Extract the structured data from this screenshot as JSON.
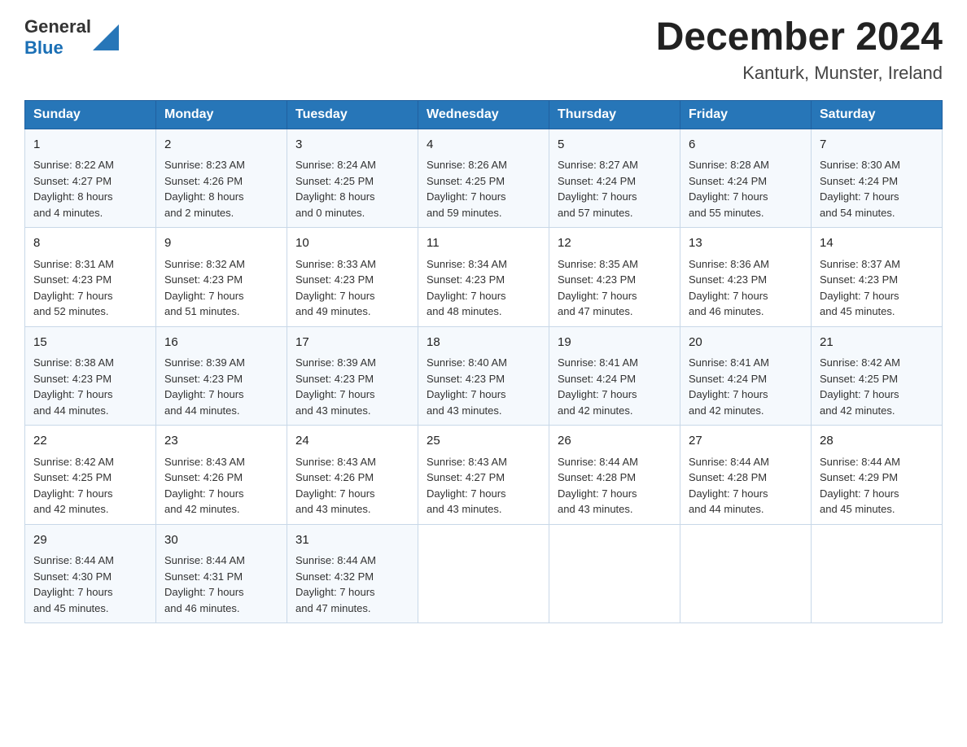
{
  "logo": {
    "text_general": "General",
    "text_blue": "Blue"
  },
  "title": "December 2024",
  "subtitle": "Kanturk, Munster, Ireland",
  "days_of_week": [
    "Sunday",
    "Monday",
    "Tuesday",
    "Wednesday",
    "Thursday",
    "Friday",
    "Saturday"
  ],
  "weeks": [
    [
      {
        "day": "1",
        "sunrise": "8:22 AM",
        "sunset": "4:27 PM",
        "daylight": "8 hours and 4 minutes."
      },
      {
        "day": "2",
        "sunrise": "8:23 AM",
        "sunset": "4:26 PM",
        "daylight": "8 hours and 2 minutes."
      },
      {
        "day": "3",
        "sunrise": "8:24 AM",
        "sunset": "4:25 PM",
        "daylight": "8 hours and 0 minutes."
      },
      {
        "day": "4",
        "sunrise": "8:26 AM",
        "sunset": "4:25 PM",
        "daylight": "7 hours and 59 minutes."
      },
      {
        "day": "5",
        "sunrise": "8:27 AM",
        "sunset": "4:24 PM",
        "daylight": "7 hours and 57 minutes."
      },
      {
        "day": "6",
        "sunrise": "8:28 AM",
        "sunset": "4:24 PM",
        "daylight": "7 hours and 55 minutes."
      },
      {
        "day": "7",
        "sunrise": "8:30 AM",
        "sunset": "4:24 PM",
        "daylight": "7 hours and 54 minutes."
      }
    ],
    [
      {
        "day": "8",
        "sunrise": "8:31 AM",
        "sunset": "4:23 PM",
        "daylight": "7 hours and 52 minutes."
      },
      {
        "day": "9",
        "sunrise": "8:32 AM",
        "sunset": "4:23 PM",
        "daylight": "7 hours and 51 minutes."
      },
      {
        "day": "10",
        "sunrise": "8:33 AM",
        "sunset": "4:23 PM",
        "daylight": "7 hours and 49 minutes."
      },
      {
        "day": "11",
        "sunrise": "8:34 AM",
        "sunset": "4:23 PM",
        "daylight": "7 hours and 48 minutes."
      },
      {
        "day": "12",
        "sunrise": "8:35 AM",
        "sunset": "4:23 PM",
        "daylight": "7 hours and 47 minutes."
      },
      {
        "day": "13",
        "sunrise": "8:36 AM",
        "sunset": "4:23 PM",
        "daylight": "7 hours and 46 minutes."
      },
      {
        "day": "14",
        "sunrise": "8:37 AM",
        "sunset": "4:23 PM",
        "daylight": "7 hours and 45 minutes."
      }
    ],
    [
      {
        "day": "15",
        "sunrise": "8:38 AM",
        "sunset": "4:23 PM",
        "daylight": "7 hours and 44 minutes."
      },
      {
        "day": "16",
        "sunrise": "8:39 AM",
        "sunset": "4:23 PM",
        "daylight": "7 hours and 44 minutes."
      },
      {
        "day": "17",
        "sunrise": "8:39 AM",
        "sunset": "4:23 PM",
        "daylight": "7 hours and 43 minutes."
      },
      {
        "day": "18",
        "sunrise": "8:40 AM",
        "sunset": "4:23 PM",
        "daylight": "7 hours and 43 minutes."
      },
      {
        "day": "19",
        "sunrise": "8:41 AM",
        "sunset": "4:24 PM",
        "daylight": "7 hours and 42 minutes."
      },
      {
        "day": "20",
        "sunrise": "8:41 AM",
        "sunset": "4:24 PM",
        "daylight": "7 hours and 42 minutes."
      },
      {
        "day": "21",
        "sunrise": "8:42 AM",
        "sunset": "4:25 PM",
        "daylight": "7 hours and 42 minutes."
      }
    ],
    [
      {
        "day": "22",
        "sunrise": "8:42 AM",
        "sunset": "4:25 PM",
        "daylight": "7 hours and 42 minutes."
      },
      {
        "day": "23",
        "sunrise": "8:43 AM",
        "sunset": "4:26 PM",
        "daylight": "7 hours and 42 minutes."
      },
      {
        "day": "24",
        "sunrise": "8:43 AM",
        "sunset": "4:26 PM",
        "daylight": "7 hours and 43 minutes."
      },
      {
        "day": "25",
        "sunrise": "8:43 AM",
        "sunset": "4:27 PM",
        "daylight": "7 hours and 43 minutes."
      },
      {
        "day": "26",
        "sunrise": "8:44 AM",
        "sunset": "4:28 PM",
        "daylight": "7 hours and 43 minutes."
      },
      {
        "day": "27",
        "sunrise": "8:44 AM",
        "sunset": "4:28 PM",
        "daylight": "7 hours and 44 minutes."
      },
      {
        "day": "28",
        "sunrise": "8:44 AM",
        "sunset": "4:29 PM",
        "daylight": "7 hours and 45 minutes."
      }
    ],
    [
      {
        "day": "29",
        "sunrise": "8:44 AM",
        "sunset": "4:30 PM",
        "daylight": "7 hours and 45 minutes."
      },
      {
        "day": "30",
        "sunrise": "8:44 AM",
        "sunset": "4:31 PM",
        "daylight": "7 hours and 46 minutes."
      },
      {
        "day": "31",
        "sunrise": "8:44 AM",
        "sunset": "4:32 PM",
        "daylight": "7 hours and 47 minutes."
      },
      null,
      null,
      null,
      null
    ]
  ],
  "labels": {
    "sunrise": "Sunrise:",
    "sunset": "Sunset:",
    "daylight": "Daylight:"
  }
}
